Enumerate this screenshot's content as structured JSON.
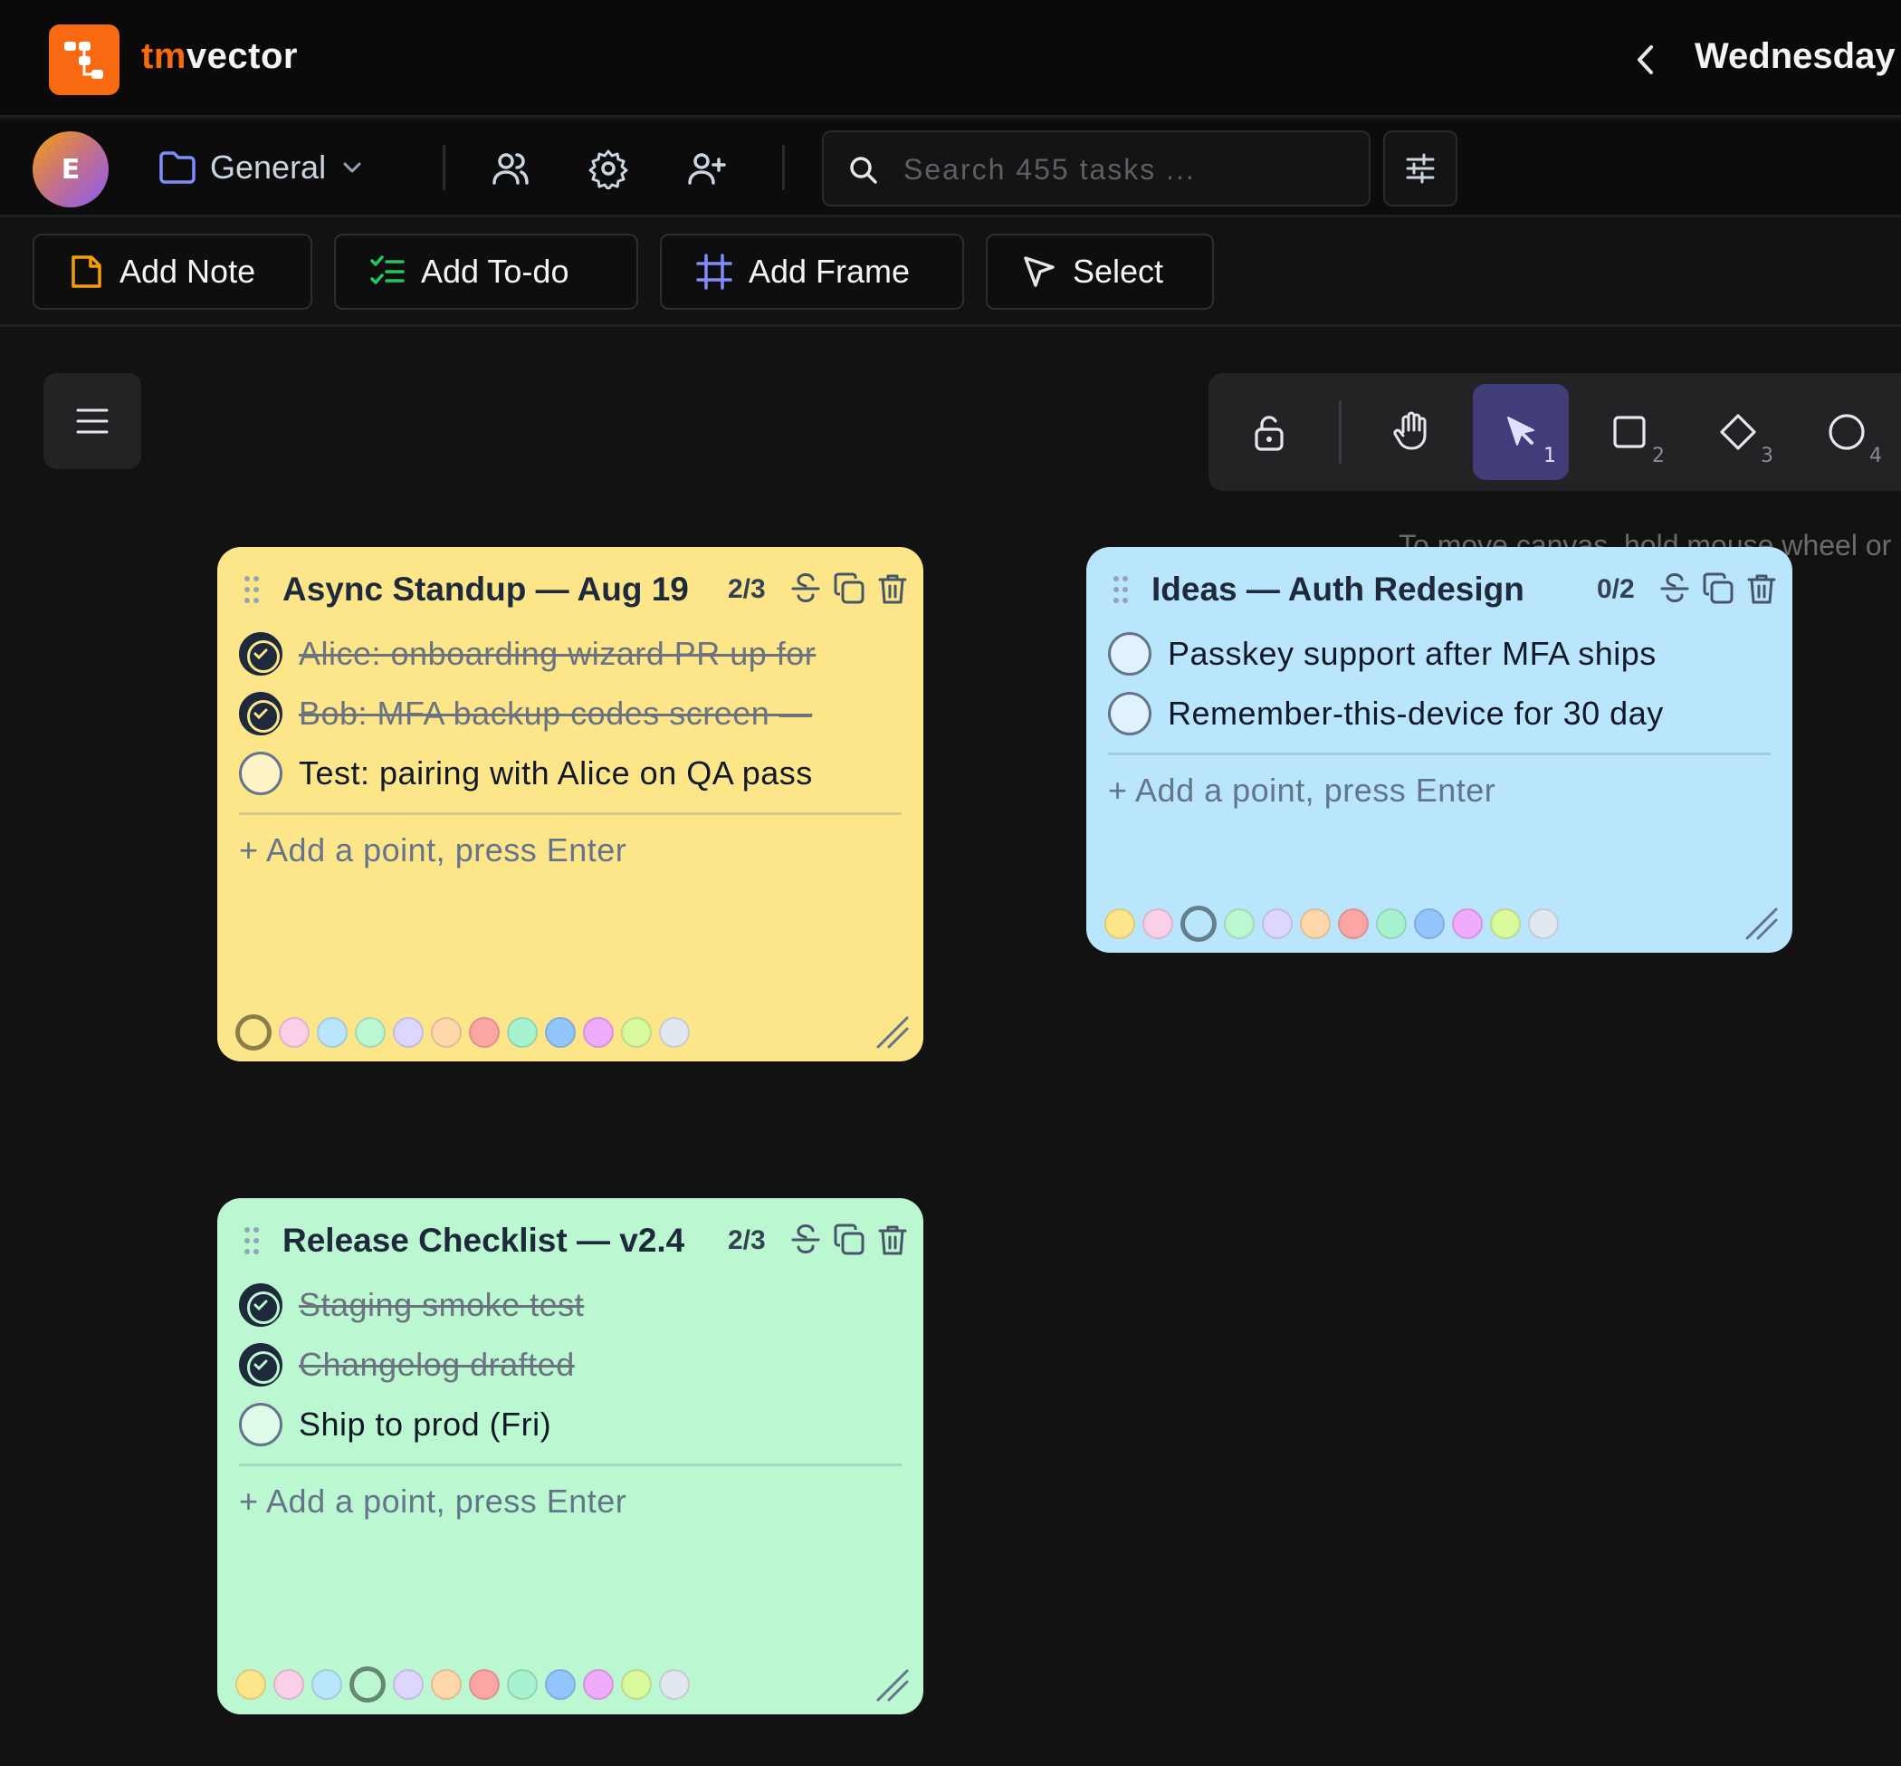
{
  "app": {
    "brand_prefix": "tm",
    "brand_suffix": "vector",
    "date_title": "Wednesday",
    "prev_day_icon": "chevron-left-icon"
  },
  "workspace_bar": {
    "avatar_initial": "E",
    "workspace_name": "General",
    "search_placeholder": "Search 455 tasks ...",
    "icons": [
      "users-icon",
      "gear-icon",
      "user-plus-icon",
      "filter-sliders-icon"
    ]
  },
  "toolbar": {
    "add_note": "Add Note",
    "add_todo": "Add To-do",
    "add_frame": "Add Frame",
    "select": "Select"
  },
  "canvas": {
    "hint": "To move canvas, hold mouse wheel or",
    "tools": [
      {
        "name": "lock",
        "key": ""
      },
      {
        "name": "hand",
        "key": ""
      },
      {
        "name": "pointer",
        "key": "1",
        "active": true
      },
      {
        "name": "rectangle",
        "key": "2"
      },
      {
        "name": "diamond",
        "key": "3"
      },
      {
        "name": "ellipse",
        "key": "4"
      }
    ]
  },
  "notes": [
    {
      "title": "Async Standup — Aug 19",
      "count": "2/3",
      "color": "#fde68a",
      "items": [
        {
          "text": "Alice: onboarding wizard PR up for",
          "done": true
        },
        {
          "text": "Bob: MFA backup codes screen —",
          "done": true
        },
        {
          "text": "Test: pairing with Alice on QA pass",
          "done": false
        }
      ],
      "add_point": "+ Add a point, press Enter"
    },
    {
      "title": "Ideas — Auth Redesign",
      "count": "0/2",
      "color": "#bae6fd",
      "items": [
        {
          "text": "Passkey support after MFA ships",
          "done": false
        },
        {
          "text": "Remember-this-device for 30 day",
          "done": false
        }
      ],
      "add_point": "+ Add a point, press Enter"
    },
    {
      "title": "Release Checklist — v2.4",
      "count": "2/3",
      "color": "#bbf7d0",
      "items": [
        {
          "text": "Staging smoke test",
          "done": true
        },
        {
          "text": "Changelog drafted",
          "done": true
        },
        {
          "text": "Ship to prod (Fri)",
          "done": false
        }
      ],
      "add_point": "+ Add a point, press Enter"
    }
  ],
  "swatch_colors": [
    "#fde68a",
    "#fbcfe8",
    "#bae6fd",
    "#bbf7d0",
    "#ddd6fe",
    "#fed7aa",
    "#fca5a5",
    "#a7f3d0",
    "#93c5fd",
    "#f0abfc",
    "#d9f99d",
    "#e2e8f0"
  ]
}
